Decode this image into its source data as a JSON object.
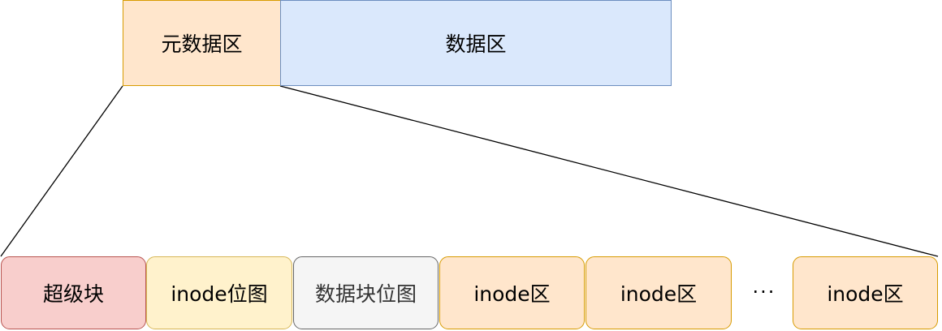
{
  "top_row": {
    "metadata_area": {
      "label": "元数据区",
      "fill": "#ffe6cc",
      "stroke": "#d79b00"
    },
    "data_area": {
      "label": "数据区",
      "fill": "#dae8fc",
      "stroke": "#6c8ebf"
    }
  },
  "bottom_row": {
    "blocks": [
      {
        "label": "超级块",
        "fill": "#f8cecc",
        "stroke": "#b85450"
      },
      {
        "label": "inode位图",
        "fill": "#fff2cc",
        "stroke": "#d6b656"
      },
      {
        "label": "数据块位图",
        "fill": "#f5f5f5",
        "stroke": "#666666",
        "text_color": "#333333"
      },
      {
        "label": "inode区",
        "fill": "#ffe6cc",
        "stroke": "#d79b00"
      },
      {
        "label": "inode区",
        "fill": "#ffe6cc",
        "stroke": "#d79b00"
      },
      {
        "label": "inode区",
        "fill": "#ffe6cc",
        "stroke": "#d79b00"
      }
    ],
    "ellipsis": "···"
  }
}
